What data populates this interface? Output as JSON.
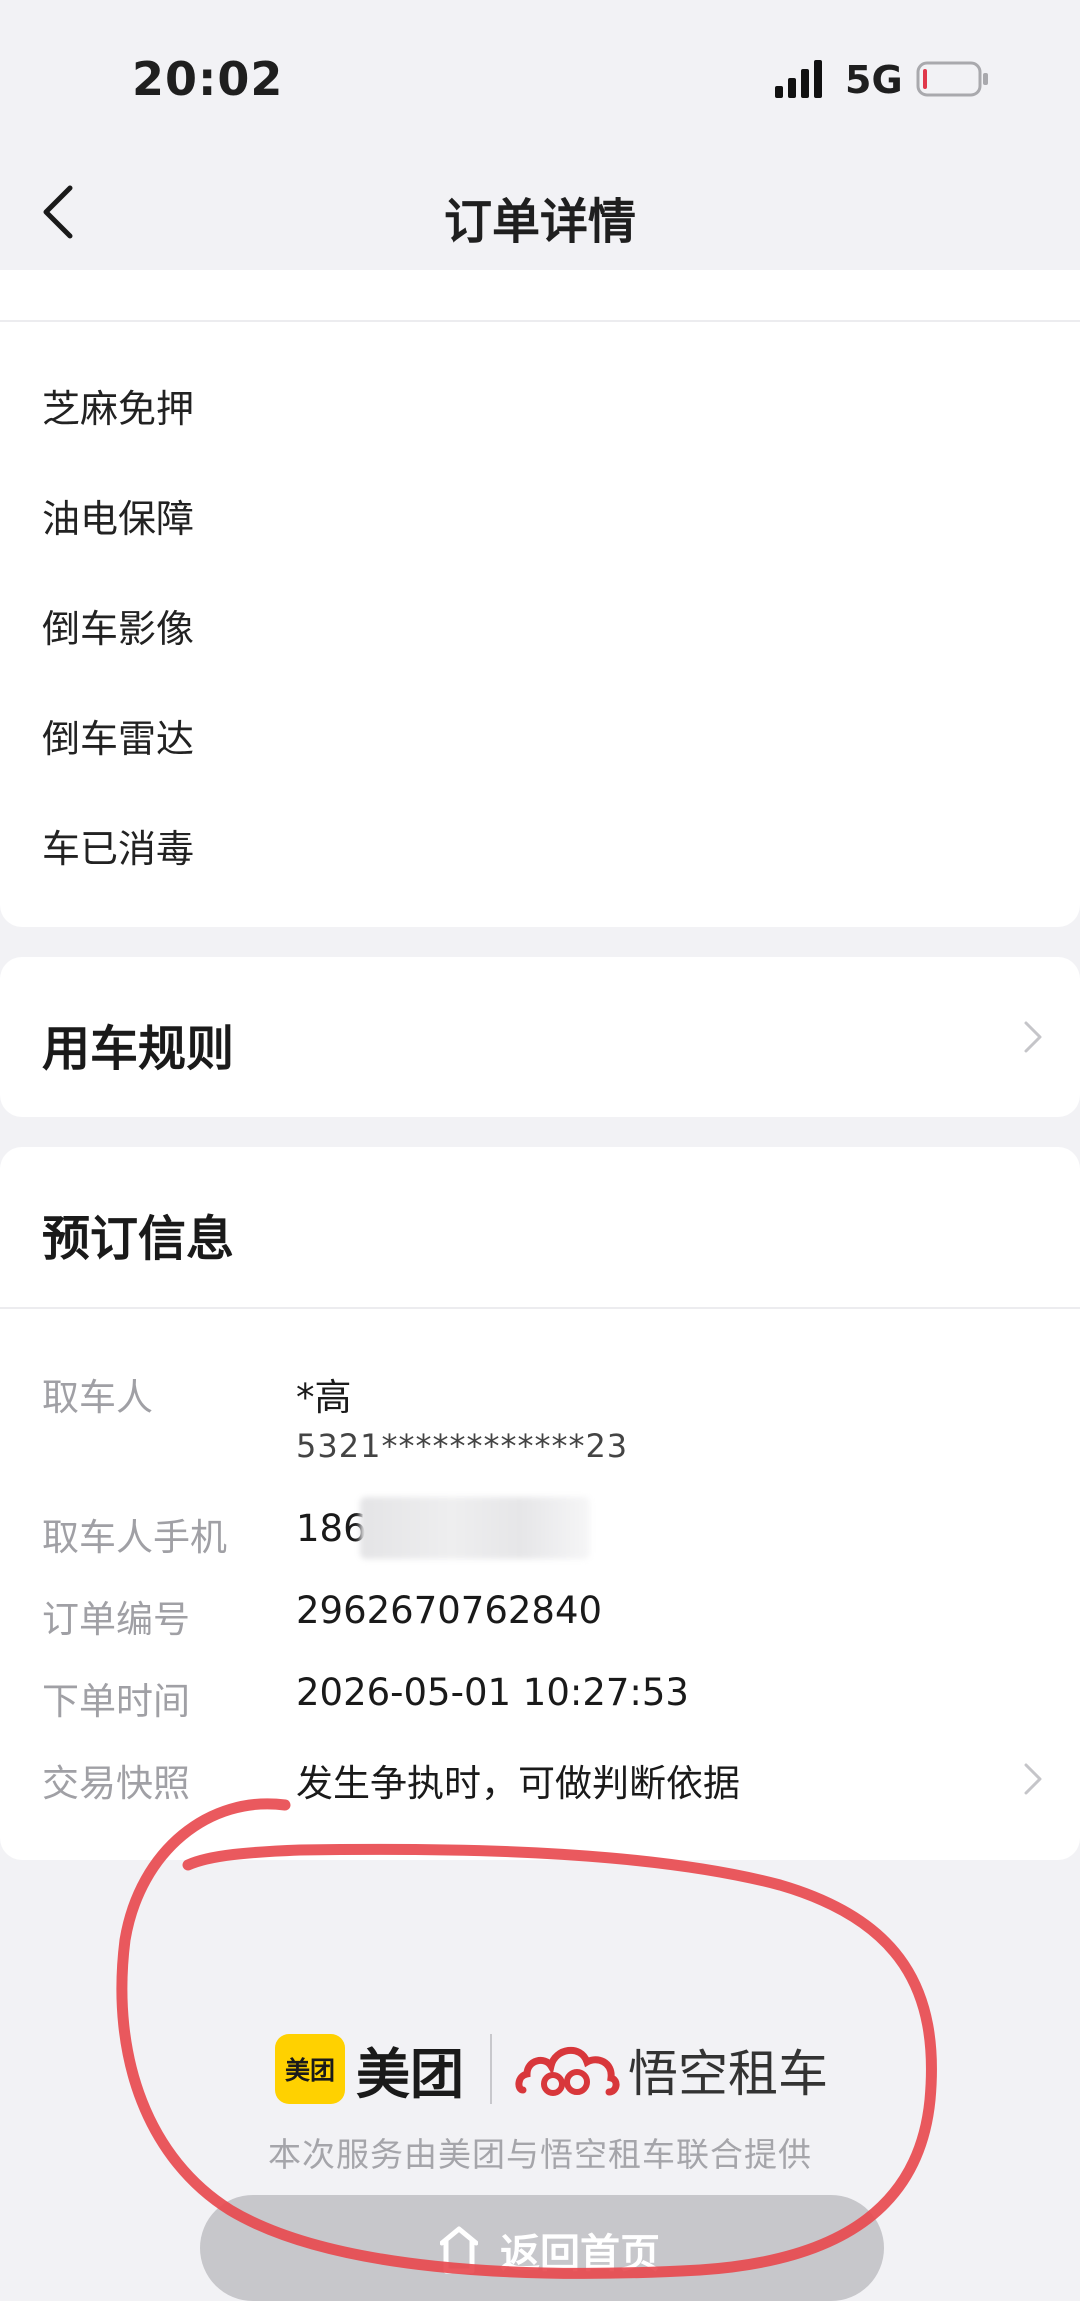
{
  "status_bar": {
    "time": "20:02",
    "network": "5G"
  },
  "nav": {
    "title": "订单详情"
  },
  "features": [
    "芝麻免押",
    "油电保障",
    "倒车影像",
    "倒车雷达",
    "车已消毒"
  ],
  "rules": {
    "title": "用车规则"
  },
  "booking": {
    "title": "预订信息",
    "pickup_person": {
      "label": "取车人",
      "name": "*高",
      "id_number": "5321************23"
    },
    "pickup_phone": {
      "label": "取车人手机",
      "value": "186"
    },
    "order_number": {
      "label": "订单编号",
      "value": "2962670762840"
    },
    "order_time": {
      "label": "下单时间",
      "value": "2026-05-01 10:27:53"
    },
    "snapshot": {
      "label": "交易快照",
      "value": "发生争执时，可做判断依据"
    }
  },
  "footer": {
    "meituan_badge": "美团",
    "meituan_name": "美团",
    "partner_name": "悟空租车",
    "note": "本次服务由美团与悟空租车联合提供"
  },
  "home_button": {
    "label": "返回首页"
  },
  "colors": {
    "meituan_yellow": "#ffd100",
    "wukong_red": "#d8373b",
    "annotation_red": "#e8474c"
  }
}
